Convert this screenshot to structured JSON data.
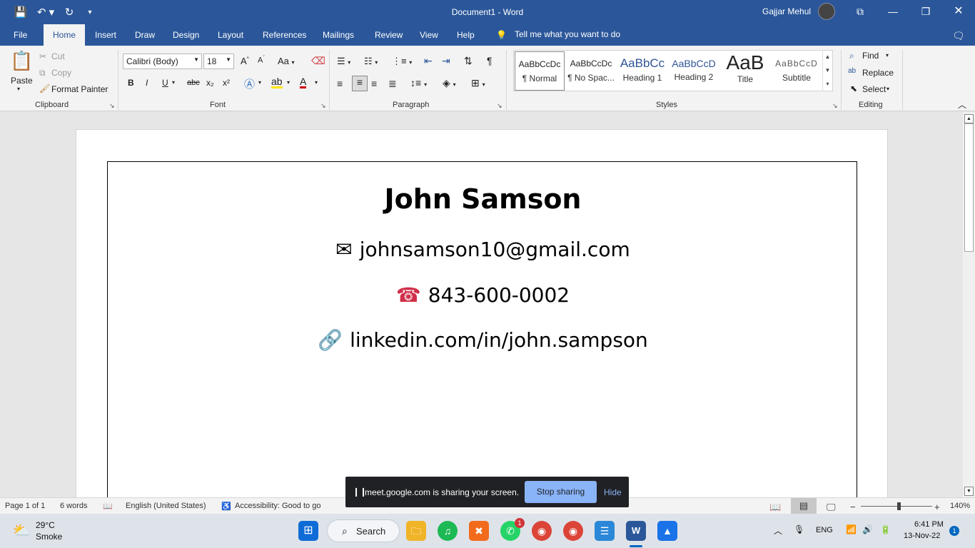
{
  "window": {
    "title": "Document1  -  Word",
    "user": "Gajjar Mehul"
  },
  "tabs": [
    "File",
    "Home",
    "Insert",
    "Draw",
    "Design",
    "Layout",
    "References",
    "Mailings",
    "Review",
    "View",
    "Help"
  ],
  "tell_me": "Tell me what you want to do",
  "clipboard": {
    "paste": "Paste",
    "cut": "Cut",
    "copy": "Copy",
    "format_painter": "Format Painter",
    "label": "Clipboard"
  },
  "font": {
    "family": "Calibri (Body)",
    "size": "18",
    "label": "Font",
    "bold": "B",
    "italic": "I",
    "underline": "U",
    "strike": "abc",
    "sub": "x₂",
    "sup": "x²",
    "case": "Aa"
  },
  "paragraph": {
    "label": "Paragraph"
  },
  "styles": {
    "label": "Styles",
    "items": [
      {
        "preview": "AaBbCcDc",
        "name": "¶ Normal"
      },
      {
        "preview": "AaBbCcDc",
        "name": "¶ No Spac..."
      },
      {
        "preview": "AaBbCc",
        "name": "Heading 1"
      },
      {
        "preview": "AaBbCcD",
        "name": "Heading 2"
      },
      {
        "preview": "AaB",
        "name": "Title"
      },
      {
        "preview": "AaBbCcD",
        "name": "Subtitle"
      }
    ]
  },
  "editing": {
    "find": "Find",
    "replace": "Replace",
    "select": "Select",
    "label": "Editing"
  },
  "document": {
    "name": "John Samson",
    "email": "johnsamson10@gmail.com",
    "phone": "843-600-0002",
    "linkedin": "linkedin.com/in/john.sampson"
  },
  "status": {
    "page": "Page 1 of 1",
    "words": "6 words",
    "language": "English (United States)",
    "accessibility": "Accessibility: Good to go",
    "zoom": "140%"
  },
  "share": {
    "message": "meet.google.com is sharing your screen.",
    "stop": "Stop sharing",
    "hide": "Hide"
  },
  "taskbar": {
    "temp": "29°C",
    "weather": "Smoke",
    "search": "Search",
    "lang": "ENG",
    "time": "6:41 PM",
    "date": "13-Nov-22",
    "notif": "1",
    "whatsapp_badge": "1"
  }
}
